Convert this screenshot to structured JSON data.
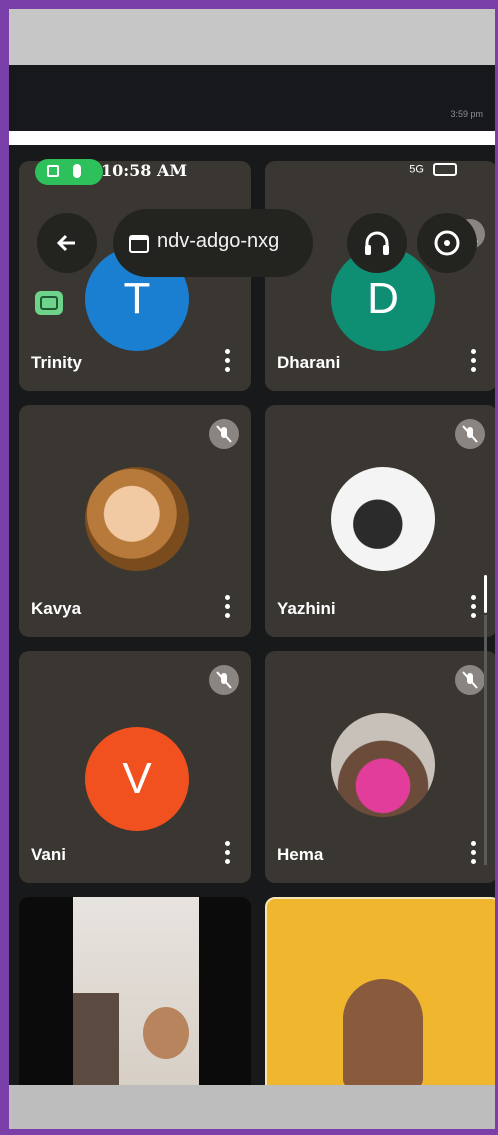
{
  "outer": {
    "time": "3:59 pm"
  },
  "status_bar": {
    "time": "10:58 AM",
    "network": "5G"
  },
  "meeting": {
    "code": "ndv-adgo-nxg"
  },
  "participants": [
    {
      "name": "Trinity",
      "initial": "T",
      "avatar_color": "#1a7fd0"
    },
    {
      "name": "Dharani",
      "initial": "D",
      "avatar_color": "#0e8f73"
    },
    {
      "name": "Kavya",
      "avatar": "photo"
    },
    {
      "name": "Yazhini",
      "avatar": "photo"
    },
    {
      "name": "Vani",
      "initial": "V",
      "avatar_color": "#f0511f"
    },
    {
      "name": "Hema",
      "avatar": "photo"
    }
  ],
  "icons": [
    "back-arrow-icon",
    "calendar-icon",
    "headphones-icon",
    "switch-camera-icon",
    "mic-off-icon",
    "more-vert-icon",
    "cast-icon",
    "record-icon",
    "mic-icon"
  ]
}
